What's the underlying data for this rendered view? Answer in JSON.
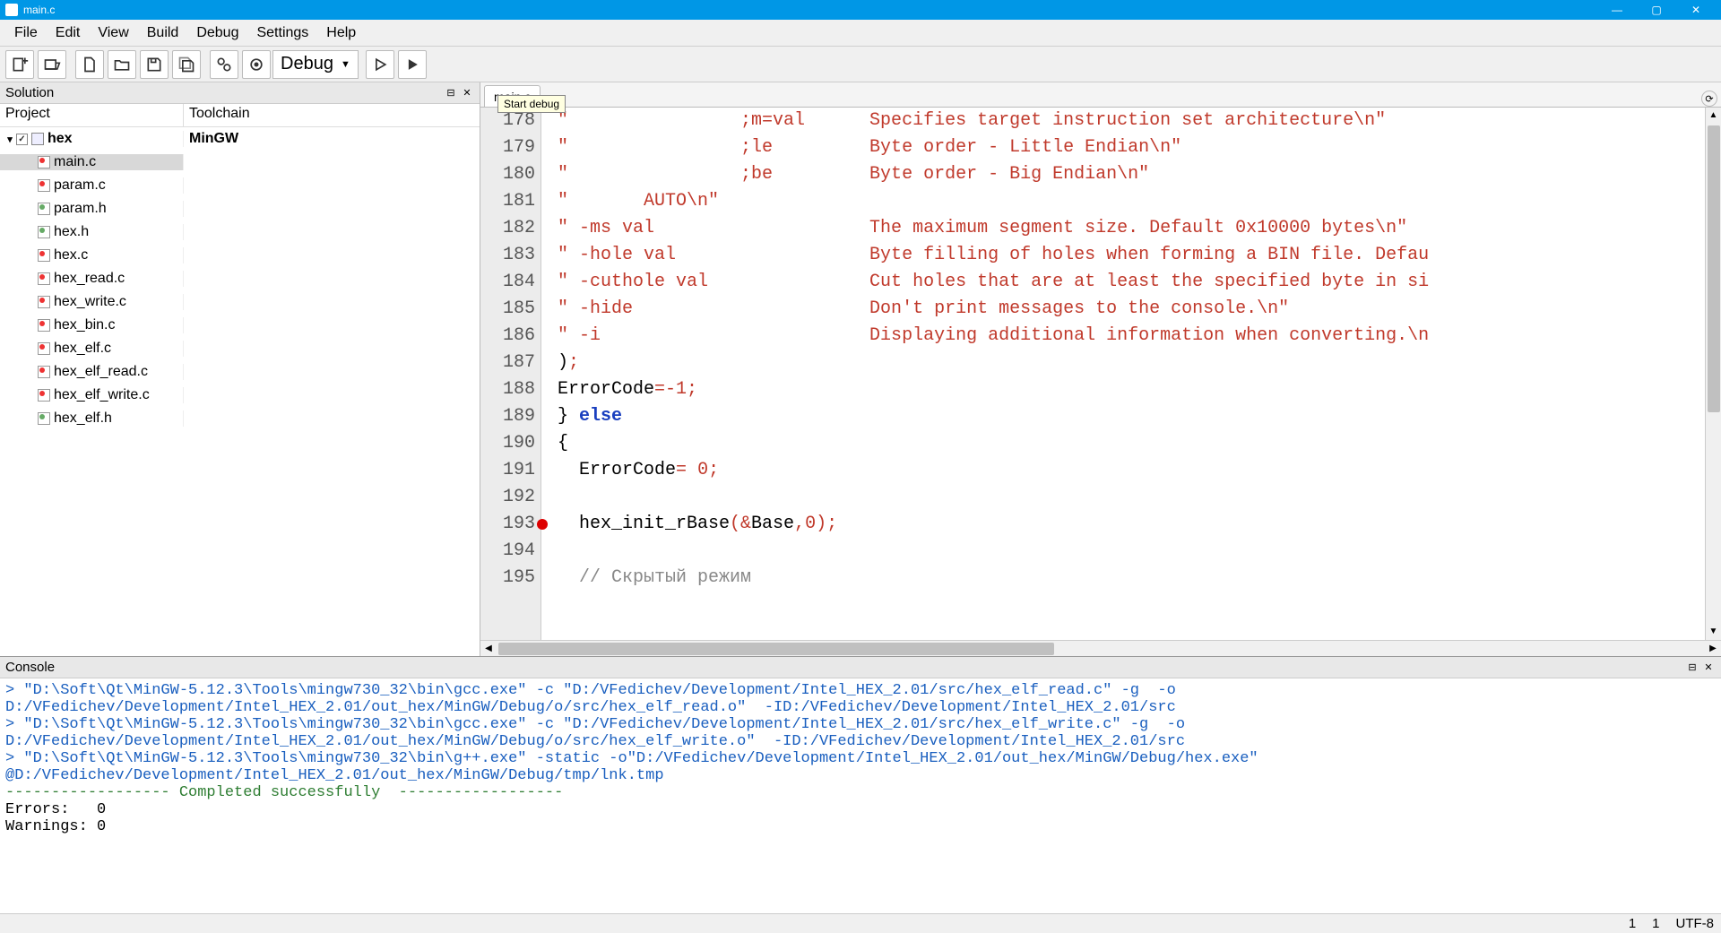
{
  "title": "main.c",
  "menus": [
    "File",
    "Edit",
    "View",
    "Build",
    "Debug",
    "Settings",
    "Help"
  ],
  "config_label": "Debug",
  "tooltip": "Start debug",
  "solution": {
    "panel_title": "Solution",
    "col_project": "Project",
    "col_toolchain": "Toolchain",
    "project_name": "hex",
    "project_toolchain": "MinGW",
    "files": [
      {
        "name": "main.c",
        "kind": "c",
        "selected": true
      },
      {
        "name": "param.c",
        "kind": "c"
      },
      {
        "name": "param.h",
        "kind": "h"
      },
      {
        "name": "hex.h",
        "kind": "h"
      },
      {
        "name": "hex.c",
        "kind": "c"
      },
      {
        "name": "hex_read.c",
        "kind": "c"
      },
      {
        "name": "hex_write.c",
        "kind": "c"
      },
      {
        "name": "hex_bin.c",
        "kind": "c"
      },
      {
        "name": "hex_elf.c",
        "kind": "c"
      },
      {
        "name": "hex_elf_read.c",
        "kind": "c"
      },
      {
        "name": "hex_elf_write.c",
        "kind": "c"
      },
      {
        "name": "hex_elf.h",
        "kind": "h"
      }
    ]
  },
  "editor": {
    "tab_label": "main.c",
    "first_line": 178,
    "breakpoint_line": 193,
    "lines": [
      {
        "n": 178,
        "html": "<span class='str'>\"                ;m=val      Specifies target instruction set architecture\\n\"</span>"
      },
      {
        "n": 179,
        "html": "<span class='str'>\"                ;le         Byte order - Little Endian\\n\"</span>"
      },
      {
        "n": 180,
        "html": "<span class='str'>\"                ;be         Byte order - Big Endian\\n\"</span>"
      },
      {
        "n": 181,
        "html": "<span class='str'>\"       AUTO\\n\"</span>"
      },
      {
        "n": 182,
        "html": "<span class='str'>\" -ms val                    The maximum segment size. Default 0x10000 bytes\\n\"</span>"
      },
      {
        "n": 183,
        "html": "<span class='str'>\" -hole val                  Byte filling of holes when forming a BIN file. Defau</span>"
      },
      {
        "n": 184,
        "html": "<span class='str'>\" -cuthole val               Cut holes that are at least the specified byte in si</span>"
      },
      {
        "n": 185,
        "html": "<span class='str'>\" -hide                      Don't print messages to the console.\\n\"</span>"
      },
      {
        "n": 186,
        "html": "<span class='str'>\" -i                         Displaying additional information when converting.\\n</span>"
      },
      {
        "n": 187,
        "html": ")<span class='op'>;</span>"
      },
      {
        "n": 188,
        "html": "ErrorCode<span class='op'>=-1;</span>"
      },
      {
        "n": 189,
        "html": "} <span class='kw'>else</span>"
      },
      {
        "n": 190,
        "html": "{"
      },
      {
        "n": 191,
        "html": "  ErrorCode<span class='op'>=</span> <span class='num'>0</span><span class='op'>;</span>"
      },
      {
        "n": 192,
        "html": ""
      },
      {
        "n": 193,
        "html": "  hex_init_rBase<span class='op'>(&amp;</span>Base<span class='op'>,</span><span class='num'>0</span><span class='op'>);</span>"
      },
      {
        "n": 194,
        "html": ""
      },
      {
        "n": 195,
        "html": "  <span class='cm'>// Скрытый режим</span>"
      }
    ]
  },
  "console": {
    "panel_title": "Console",
    "lines": [
      {
        "cls": "blue",
        "text": "> \"D:\\Soft\\Qt\\MinGW-5.12.3\\Tools\\mingw730_32\\bin\\gcc.exe\" -c \"D:/VFedichev/Development/Intel_HEX_2.01/src/hex_elf_read.c\" -g  -o"
      },
      {
        "cls": "blue",
        "text": "D:/VFedichev/Development/Intel_HEX_2.01/out_hex/MinGW/Debug/o/src/hex_elf_read.o\"  -ID:/VFedichev/Development/Intel_HEX_2.01/src"
      },
      {
        "cls": "",
        "text": ""
      },
      {
        "cls": "blue",
        "text": "> \"D:\\Soft\\Qt\\MinGW-5.12.3\\Tools\\mingw730_32\\bin\\gcc.exe\" -c \"D:/VFedichev/Development/Intel_HEX_2.01/src/hex_elf_write.c\" -g  -o"
      },
      {
        "cls": "blue",
        "text": "D:/VFedichev/Development/Intel_HEX_2.01/out_hex/MinGW/Debug/o/src/hex_elf_write.o\"  -ID:/VFedichev/Development/Intel_HEX_2.01/src"
      },
      {
        "cls": "",
        "text": ""
      },
      {
        "cls": "blue",
        "text": "> \"D:\\Soft\\Qt\\MinGW-5.12.3\\Tools\\mingw730_32\\bin\\g++.exe\" -static -o\"D:/VFedichev/Development/Intel_HEX_2.01/out_hex/MinGW/Debug/hex.exe\""
      },
      {
        "cls": "blue",
        "text": "@D:/VFedichev/Development/Intel_HEX_2.01/out_hex/MinGW/Debug/tmp/lnk.tmp"
      },
      {
        "cls": "",
        "text": ""
      },
      {
        "cls": "green",
        "text": "------------------ Completed successfully  ------------------"
      },
      {
        "cls": "",
        "text": "Errors:   0"
      },
      {
        "cls": "",
        "text": "Warnings: 0"
      }
    ]
  },
  "status": {
    "line": "1",
    "col": "1",
    "encoding": "UTF-8"
  }
}
